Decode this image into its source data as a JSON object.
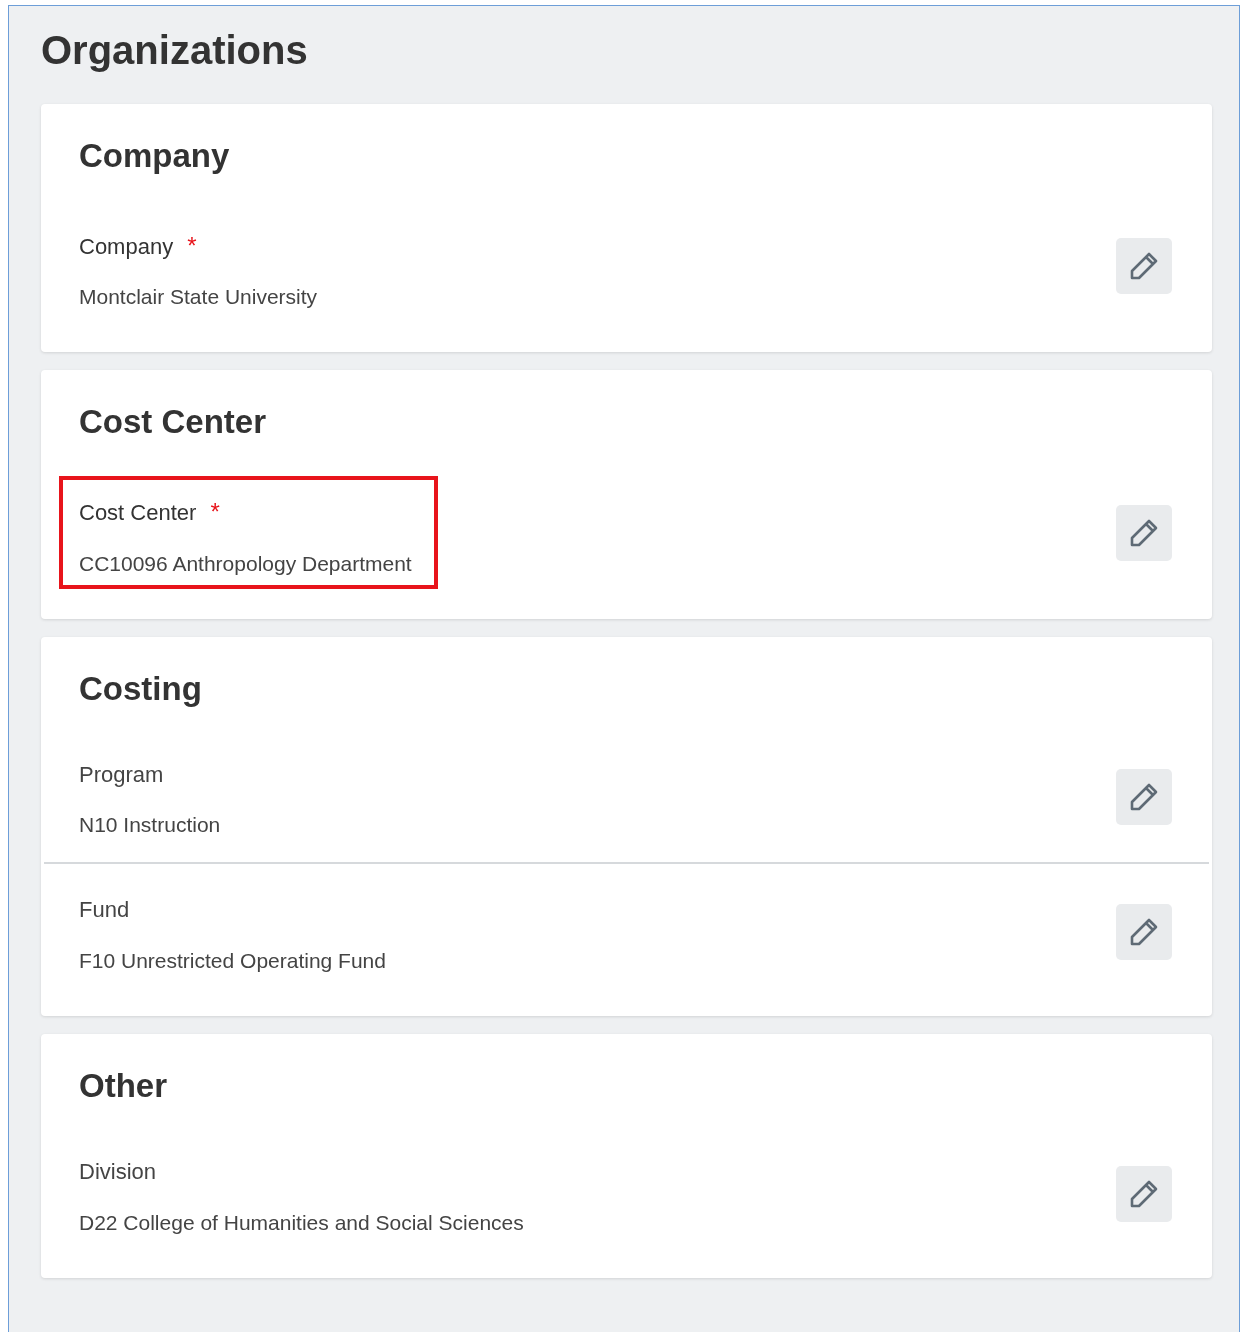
{
  "title": "Organizations",
  "sections": [
    {
      "heading": "Company",
      "fields": [
        {
          "label": "Company",
          "required_mark": "*",
          "value": "Montclair State University",
          "highlighted": false
        }
      ]
    },
    {
      "heading": "Cost Center",
      "fields": [
        {
          "label": "Cost Center",
          "required_mark": "*",
          "value": "CC10096 Anthropology Department",
          "highlighted": true
        }
      ]
    },
    {
      "heading": "Costing",
      "fields": [
        {
          "label": "Program",
          "value": "N10 Instruction",
          "highlighted": false
        },
        {
          "label": "Fund",
          "value": "F10 Unrestricted Operating Fund",
          "highlighted": false
        }
      ]
    },
    {
      "heading": "Other",
      "fields": [
        {
          "label": "Division",
          "value": "D22 College of Humanities and Social Sciences",
          "highlighted": false
        }
      ]
    }
  ]
}
